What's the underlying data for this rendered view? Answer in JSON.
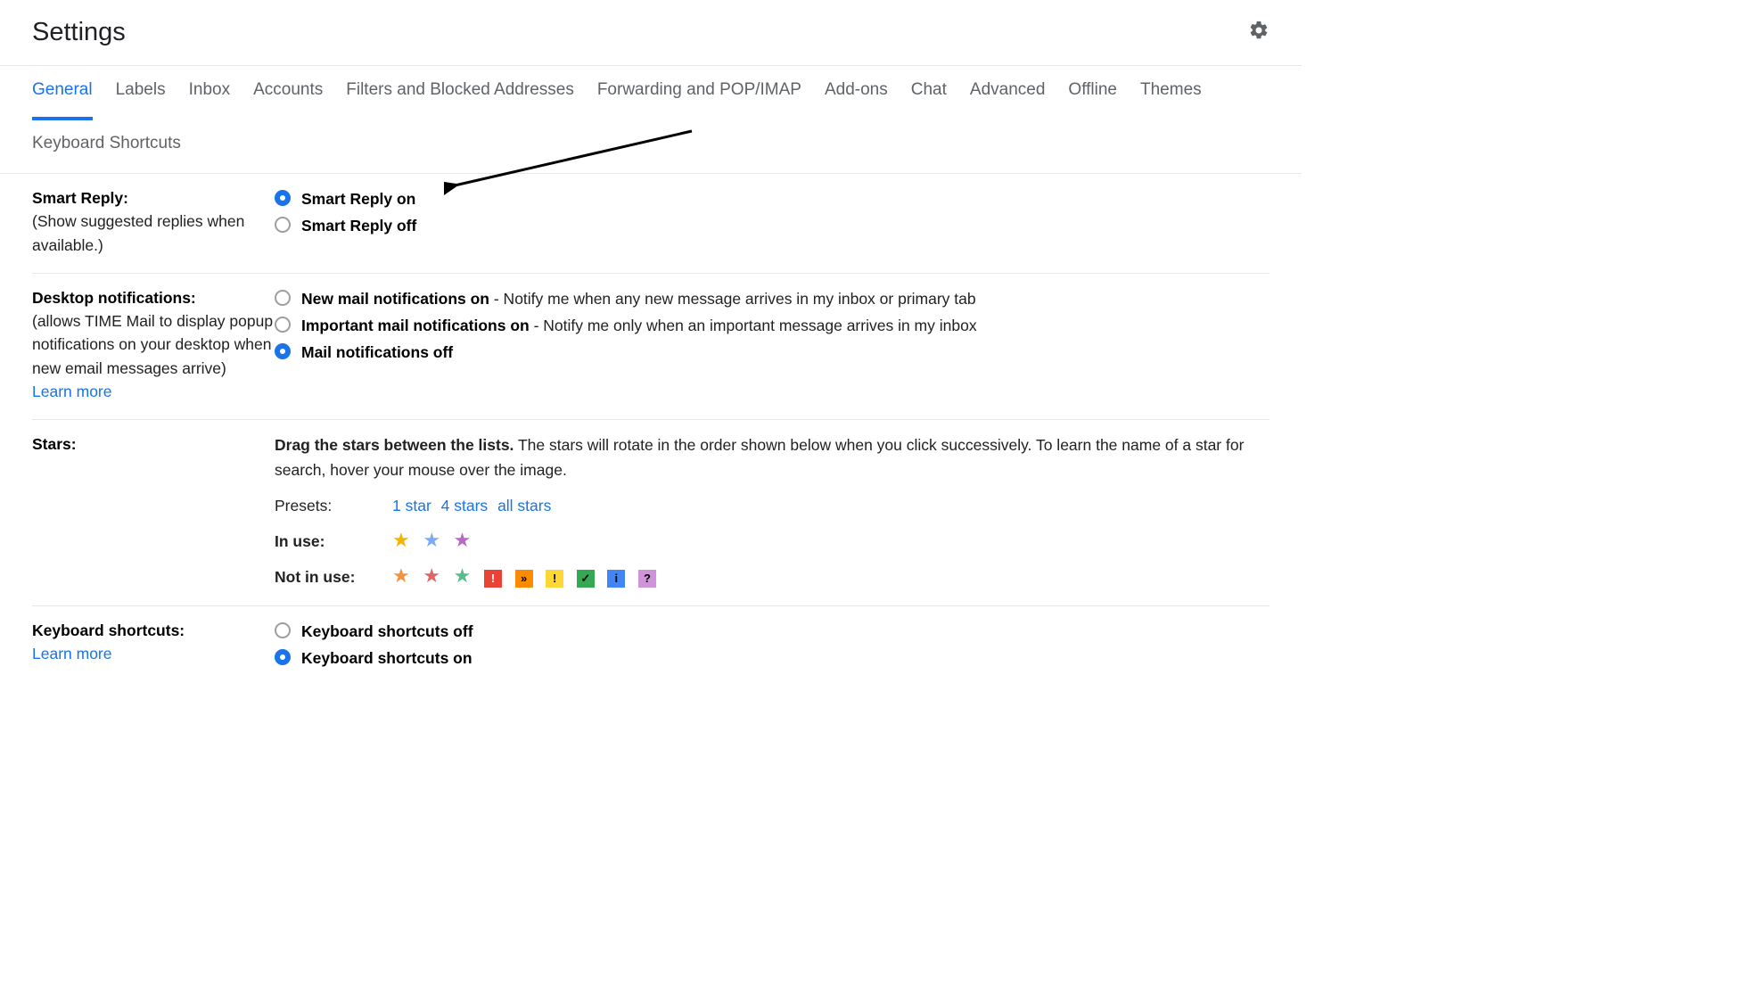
{
  "header": {
    "title": "Settings",
    "gearIcon": "gear-icon"
  },
  "tabs": [
    {
      "id": "general",
      "label": "General",
      "active": true
    },
    {
      "id": "labels",
      "label": "Labels"
    },
    {
      "id": "inbox",
      "label": "Inbox"
    },
    {
      "id": "accounts",
      "label": "Accounts"
    },
    {
      "id": "filters",
      "label": "Filters and Blocked Addresses"
    },
    {
      "id": "forwarding",
      "label": "Forwarding and POP/IMAP"
    },
    {
      "id": "addons",
      "label": "Add-ons"
    },
    {
      "id": "chat",
      "label": "Chat"
    },
    {
      "id": "advanced",
      "label": "Advanced"
    },
    {
      "id": "offline",
      "label": "Offline"
    },
    {
      "id": "themes",
      "label": "Themes"
    },
    {
      "id": "keyboard",
      "label": "Keyboard Shortcuts"
    }
  ],
  "smartReply": {
    "title": "Smart Reply:",
    "desc": "(Show suggested replies when available.)",
    "options": [
      {
        "label": "Smart Reply on",
        "checked": true
      },
      {
        "label": "Smart Reply off",
        "checked": false
      }
    ]
  },
  "desktopNotifications": {
    "title": "Desktop notifications:",
    "desc": "(allows TIME Mail to display popup notifications on your desktop when new email messages arrive)",
    "learnMore": "Learn more",
    "options": [
      {
        "bold": "New mail notifications on",
        "sub": " - Notify me when any new message arrives in my inbox or primary tab",
        "checked": false
      },
      {
        "bold": "Important mail notifications on",
        "sub": " - Notify me only when an important message arrives in my inbox",
        "checked": false
      },
      {
        "bold": "Mail notifications off",
        "sub": "",
        "checked": true
      }
    ]
  },
  "stars": {
    "title": "Stars:",
    "descBold": "Drag the stars between the lists.",
    "descRest": "  The stars will rotate in the order shown below when you click successively. To learn the name of a star for search, hover your mouse over the image.",
    "presetsLabel": "Presets:",
    "presets": [
      "1 star",
      "4 stars",
      "all stars"
    ],
    "inUseLabel": "In use:",
    "inUse": [
      {
        "type": "star",
        "color": "#f4b400",
        "name": "yellow-star"
      },
      {
        "type": "star",
        "color": "#7baaf7",
        "name": "blue-star"
      },
      {
        "type": "star",
        "color": "#ba68c8",
        "name": "purple-star"
      }
    ],
    "notInUseLabel": "Not in use:",
    "notInUse": [
      {
        "type": "star",
        "color": "#f4923e",
        "name": "orange-star"
      },
      {
        "type": "star",
        "color": "#e06666",
        "name": "red-star"
      },
      {
        "type": "star",
        "color": "#57bb8a",
        "name": "green-star"
      },
      {
        "type": "square",
        "bg": "#ea4335",
        "glyph": "!",
        "glyphColor": "#fff",
        "name": "red-bang"
      },
      {
        "type": "square",
        "bg": "#fb8c00",
        "glyph": "»",
        "glyphColor": "#000",
        "name": "orange-guillemet"
      },
      {
        "type": "square",
        "bg": "#fdd835",
        "glyph": "!",
        "glyphColor": "#000",
        "name": "yellow-bang"
      },
      {
        "type": "square",
        "bg": "#34a853",
        "glyph": "✓",
        "glyphColor": "#000",
        "name": "green-check"
      },
      {
        "type": "square",
        "bg": "#4285f4",
        "glyph": "i",
        "glyphColor": "#000",
        "name": "blue-info"
      },
      {
        "type": "square",
        "bg": "#ce93d8",
        "glyph": "?",
        "glyphColor": "#000",
        "name": "purple-question"
      }
    ]
  },
  "keyboardShortcuts": {
    "title": "Keyboard shortcuts:",
    "learnMore": "Learn more",
    "options": [
      {
        "label": "Keyboard shortcuts off",
        "checked": false
      },
      {
        "label": "Keyboard shortcuts on",
        "checked": true
      }
    ]
  }
}
